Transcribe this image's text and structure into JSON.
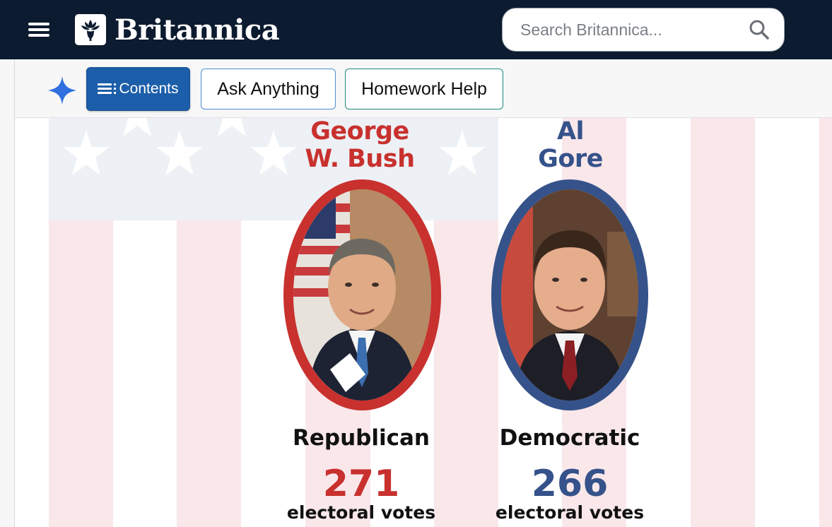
{
  "header": {
    "brand_name": "Britannica",
    "search": {
      "placeholder": "Search Britannica..."
    },
    "icons": [
      "menu-icon",
      "britannica-thistle-logo",
      "search-icon"
    ]
  },
  "toolbar": {
    "contents_label": "Contents",
    "ask_label": "Ask Anything",
    "homework_label": "Homework Help",
    "icons": [
      "sparkle-icon",
      "list-icon"
    ]
  },
  "infographic": {
    "candidates": [
      {
        "name_line1": "George",
        "name_line2": "W. Bush",
        "party": "Republican",
        "electoral_votes": "271",
        "votes_label": "electoral votes",
        "color": "#c8312e"
      },
      {
        "name_line1": "Al",
        "name_line2": "Gore",
        "party": "Democratic",
        "electoral_votes": "266",
        "votes_label": "electoral votes",
        "color": "#35528a"
      }
    ],
    "colors": {
      "stripe": "#f9e7ea",
      "canton": "#edf0f5"
    }
  },
  "colors": {
    "topbar": "#0c1b2f",
    "contents_button": "#1c5ea9",
    "ask_border": "#4b8fd3",
    "homework_border": "#1d8a7c",
    "sparkle": "#2f6fe0"
  }
}
